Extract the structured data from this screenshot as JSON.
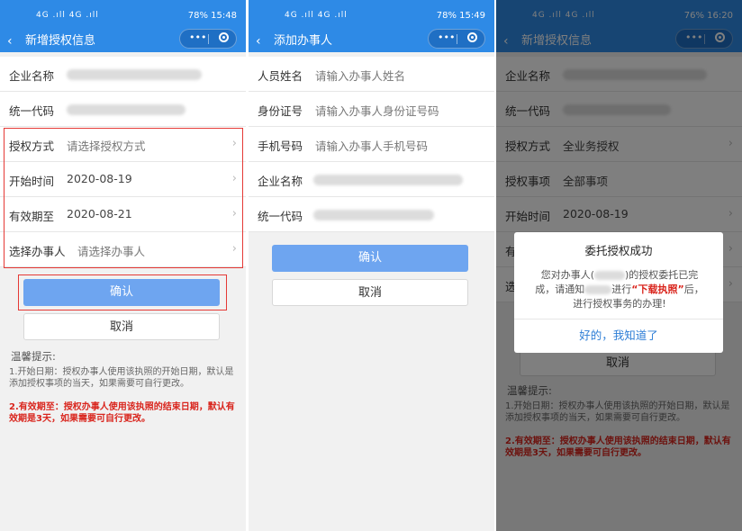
{
  "panel1": {
    "status": {
      "signal": "4G .ıll 4G .ıll",
      "right": "78% 15:48"
    },
    "title": "新增授权信息",
    "rows": [
      {
        "label": "企业名称",
        "value": ""
      },
      {
        "label": "统一代码",
        "value": ""
      },
      {
        "label": "授权方式",
        "value": "请选择授权方式"
      },
      {
        "label": "开始时间",
        "value": "2020-08-19"
      },
      {
        "label": "有效期至",
        "value": "2020-08-21"
      },
      {
        "label": "选择办事人",
        "value": "请选择办事人"
      }
    ],
    "confirm": "确认",
    "cancel": "取消",
    "tips_title": "温馨提示:",
    "tip1": "1.开始日期：授权办事人使用该执照的开始日期，默认是添加授权事项的当天，如果需要可自行更改。",
    "tip2": "2.有效期至：授权办事人使用该执照的结束日期，默认有效期是3天，如果需要可自行更改。"
  },
  "panel2": {
    "status": {
      "signal": "4G .ıll 4G .ıll",
      "right": "78% 15:49"
    },
    "title": "添加办事人",
    "rows": [
      {
        "label": "人员姓名",
        "value": "请输入办事人姓名"
      },
      {
        "label": "身份证号",
        "value": "请输入办事人身份证号码"
      },
      {
        "label": "手机号码",
        "value": "请输入办事人手机号码"
      },
      {
        "label": "企业名称",
        "value": ""
      },
      {
        "label": "统一代码",
        "value": ""
      }
    ],
    "confirm": "确认",
    "cancel": "取消"
  },
  "panel3": {
    "status": {
      "signal": "4G .ıll 4G .ıll",
      "right": "76% 16:20"
    },
    "title": "新增授权信息",
    "rows": [
      {
        "label": "企业名称",
        "value": ""
      },
      {
        "label": "统一代码",
        "value": ""
      },
      {
        "label": "授权方式",
        "value": "全业务授权"
      },
      {
        "label": "授权事项",
        "value": "全部事项"
      },
      {
        "label": "开始时间",
        "value": "2020-08-19"
      },
      {
        "label": "有",
        "value": ""
      },
      {
        "label": "选",
        "value": ""
      }
    ],
    "cancel": "取消",
    "tips_title": "温馨提示:",
    "tip1": "1.开始日期：授权办事人使用该执照的开始日期，默认是添加授权事项的当天，如果需要可自行更改。",
    "tip2": "2.有效期至：授权办事人使用该执照的结束日期，默认有效期是3天，如果需要可自行更改。",
    "dialog": {
      "title": "委托授权成功",
      "body_a": "您对办事人(",
      "body_b": ")的授权委托已完成，请通知",
      "body_c": "进行",
      "body_highlight": "“下载执照”",
      "body_d": "后，进行授权事务的办理!",
      "button": "好的，我知道了"
    }
  },
  "colors": {
    "header": "#2e8ae6",
    "confirm": "#6ea5f0",
    "highlight_red": "#d9251d",
    "link_blue": "#2e7ed6"
  }
}
